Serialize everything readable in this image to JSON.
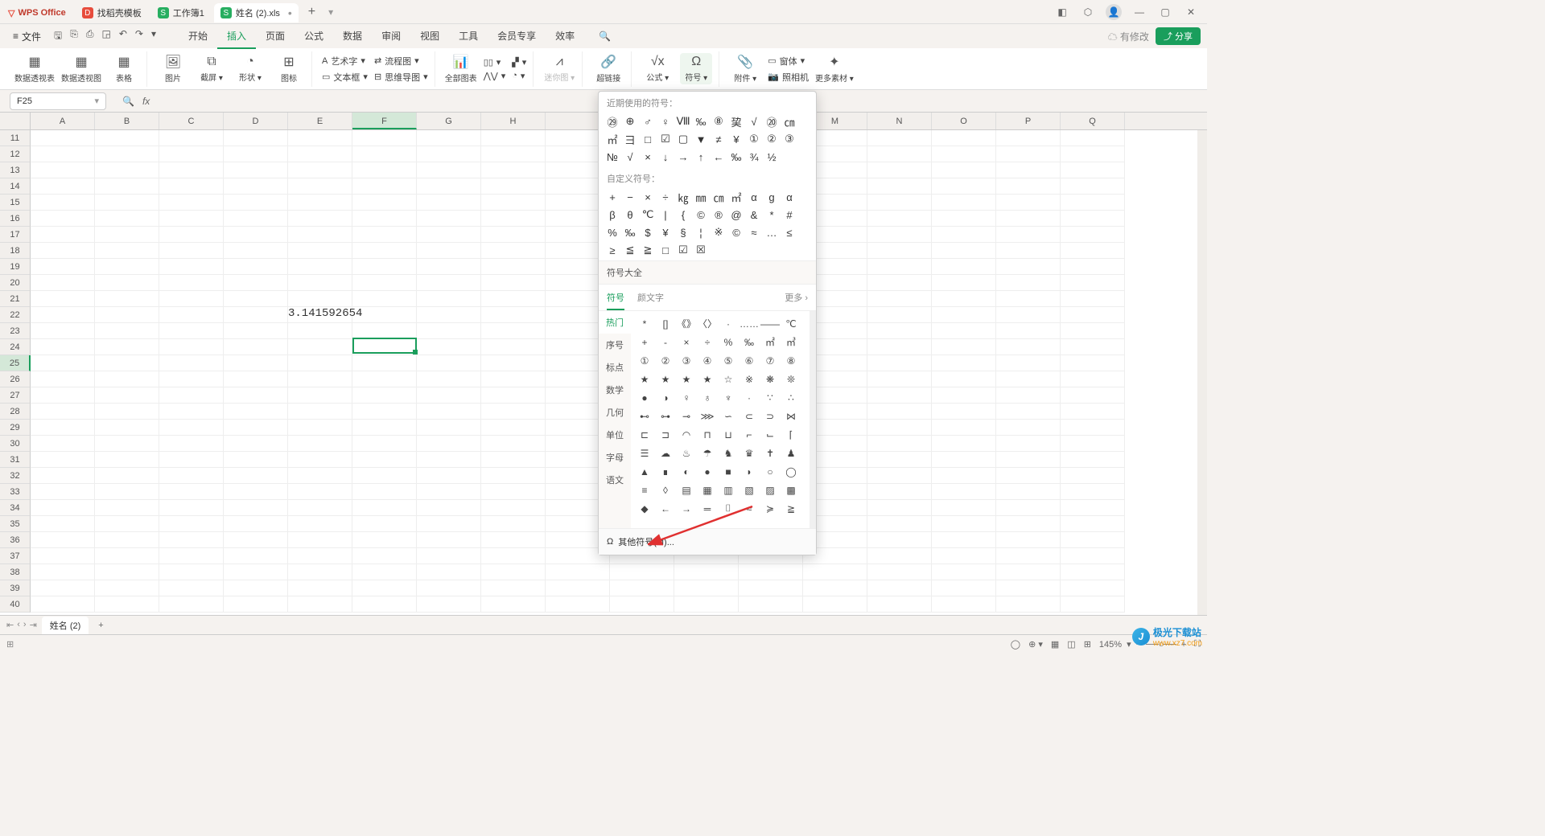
{
  "titlebar": {
    "app": "WPS Office",
    "tabs": [
      {
        "icon": "D",
        "iconClass": "red",
        "label": "找稻壳模板"
      },
      {
        "icon": "S",
        "iconClass": "green",
        "label": "工作簿1"
      },
      {
        "icon": "S",
        "iconClass": "green",
        "label": "姓名 (2).xls",
        "active": true,
        "dirty": "•"
      }
    ],
    "add": "+"
  },
  "menubar": {
    "file": "文件",
    "tabs": [
      "开始",
      "插入",
      "页面",
      "公式",
      "数据",
      "审阅",
      "视图",
      "工具",
      "会员专享",
      "效率"
    ],
    "activeTab": "插入",
    "pending": "有修改",
    "share": "分享"
  },
  "ribbon": {
    "g1": {
      "a": "数据透视表",
      "b": "数据透视图",
      "c": "表格"
    },
    "g2": {
      "a": "图片",
      "b": "截屏",
      "c": "形状",
      "d": "图标"
    },
    "g3": {
      "a": "艺术字",
      "b": "流程图",
      "c": "文本框",
      "d": "思维导图"
    },
    "g4": {
      "a": "全部图表"
    },
    "g5": {
      "a": "迷你图"
    },
    "g6": {
      "a": "超链接"
    },
    "g7": {
      "a": "公式",
      "b": "符号"
    },
    "g8": {
      "a": "附件",
      "b": "窗体",
      "c": "照相机",
      "d": "更多素材"
    }
  },
  "formula": {
    "nameBox": "F25",
    "fx": "fx"
  },
  "sheet": {
    "cols": [
      "A",
      "B",
      "C",
      "D",
      "E",
      "F",
      "G",
      "H",
      "",
      "",
      "",
      "",
      "M",
      "N",
      "O",
      "P",
      "Q"
    ],
    "selCol": "F",
    "rowStart": 11,
    "rowEnd": 40,
    "selRow": 25,
    "value": "3.141592654"
  },
  "symbolPanel": {
    "recent": "近期使用的符号：",
    "recentSyms": [
      "㉙",
      "⊕",
      "♂",
      "♀",
      "Ⅷ",
      "‰",
      "⑧",
      "巭",
      "√",
      "⑳",
      "㎝",
      "㎡",
      "⺕",
      "□",
      "☑",
      "▢",
      "▼",
      "≠",
      "¥",
      "①",
      "②",
      "③",
      "№",
      "√",
      "×",
      "↓",
      "→",
      "↑",
      "←",
      "‰",
      "¾",
      "½"
    ],
    "custom": "自定义符号：",
    "customSyms": [
      "+",
      "−",
      "×",
      "÷",
      "㎏",
      "㎜",
      "㎝",
      "㎡",
      "α",
      "ɡ",
      "α",
      "β",
      "θ",
      "℃",
      "|",
      "{",
      "©",
      "®",
      "@",
      "&",
      "*",
      "#",
      "%",
      "‰",
      "$",
      "¥",
      "§",
      "¦",
      "※",
      "©",
      "≈",
      "…",
      "≤",
      "≥",
      "≦",
      "≧",
      "□",
      "☑",
      "☒"
    ],
    "all": "符号大全",
    "tabs": {
      "a": "符号",
      "b": "颜文字",
      "more": "更多"
    },
    "cats": [
      "热门",
      "序号",
      "标点",
      "数学",
      "几何",
      "单位",
      "字母",
      "语文"
    ],
    "grid": [
      [
        "*",
        "[]",
        "《》",
        "〈〉",
        "·",
        "……",
        "——",
        "℃"
      ],
      [
        "+",
        "-",
        "×",
        "÷",
        "%",
        "‰",
        "㎡",
        "㎥"
      ],
      [
        "①",
        "②",
        "③",
        "④",
        "⑤",
        "⑥",
        "⑦",
        "⑧"
      ],
      [
        "★",
        "★",
        "★",
        "★",
        "☆",
        "※",
        "❋",
        "❊"
      ],
      [
        "●",
        "◑",
        "♀",
        "♁",
        "♆",
        "·",
        "∵",
        "∴"
      ],
      [
        "⊷",
        "⊶",
        "⊸",
        "⋙",
        "∽",
        "⊂",
        "⊃",
        "⋈"
      ],
      [
        "⊏",
        "⊐",
        "◠",
        "⊓",
        "⊔",
        "⌐",
        "⌙",
        "⌈"
      ],
      [
        "☰",
        "☁",
        "♨",
        "☂",
        "♞",
        "♛",
        "✝",
        "♟"
      ],
      [
        "▲",
        "∎",
        "◐",
        "●",
        "■",
        "◗",
        "○",
        "◯"
      ],
      [
        "≡",
        "◊",
        "▤",
        "▦",
        "▥",
        "▧",
        "▨",
        "▩"
      ],
      [
        "◆",
        "←",
        "→",
        "═",
        "⌷",
        "≈",
        "≽",
        "≧"
      ]
    ],
    "footer": "其他符号(M)..."
  },
  "sheetTabs": {
    "name": "姓名 (2)",
    "add": "+"
  },
  "status": {
    "zoom": "145%"
  },
  "watermark": {
    "brand": "极光下载站",
    "url": "www.xz7.com"
  }
}
